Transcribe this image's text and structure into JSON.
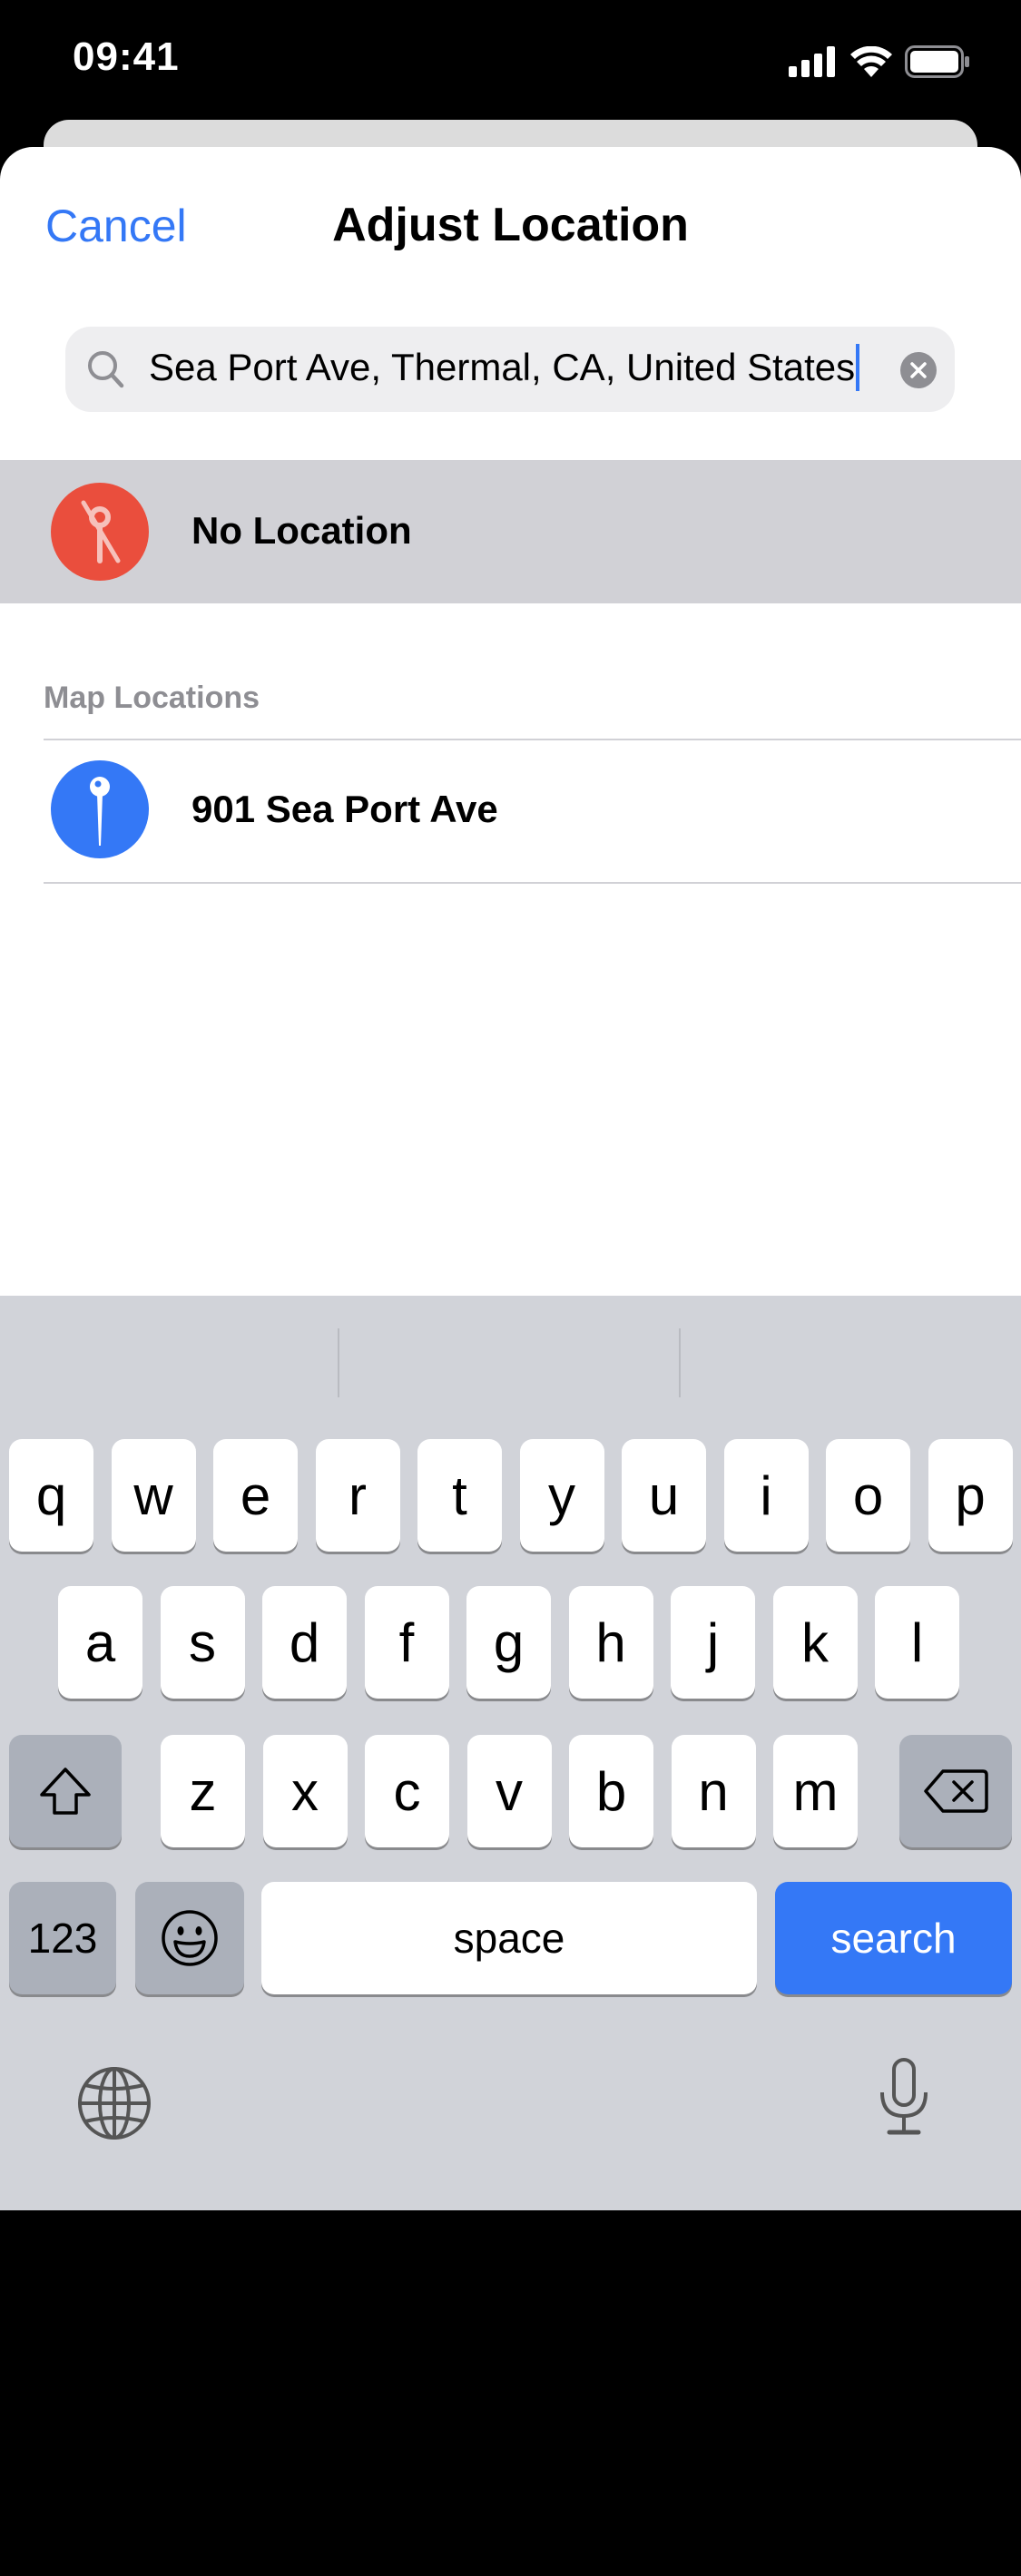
{
  "status_bar": {
    "time": "09:41",
    "icons": [
      "signal-icon",
      "wifi-icon",
      "battery-icon"
    ]
  },
  "header": {
    "cancel_label": "Cancel",
    "title": "Adjust Location"
  },
  "search": {
    "value": "Sea Port Ave, Thermal, CA, United States",
    "icon": "search-icon",
    "clear_icon": "clear-icon"
  },
  "no_location": {
    "label": "No Location",
    "icon": "location-slash-icon",
    "color": "#ea4e3d"
  },
  "map_locations": {
    "header": "Map Locations",
    "items": [
      {
        "label": "901 Sea Port Ave",
        "icon": "pin-icon",
        "color": "#3478f6"
      }
    ]
  },
  "keyboard": {
    "row1": [
      "q",
      "w",
      "e",
      "r",
      "t",
      "y",
      "u",
      "i",
      "o",
      "p"
    ],
    "row2": [
      "a",
      "s",
      "d",
      "f",
      "g",
      "h",
      "j",
      "k",
      "l"
    ],
    "row3": [
      "z",
      "x",
      "c",
      "v",
      "b",
      "n",
      "m"
    ],
    "numbers_label": "123",
    "space_label": "space",
    "search_label": "search",
    "accent_color": "#3478f6"
  }
}
